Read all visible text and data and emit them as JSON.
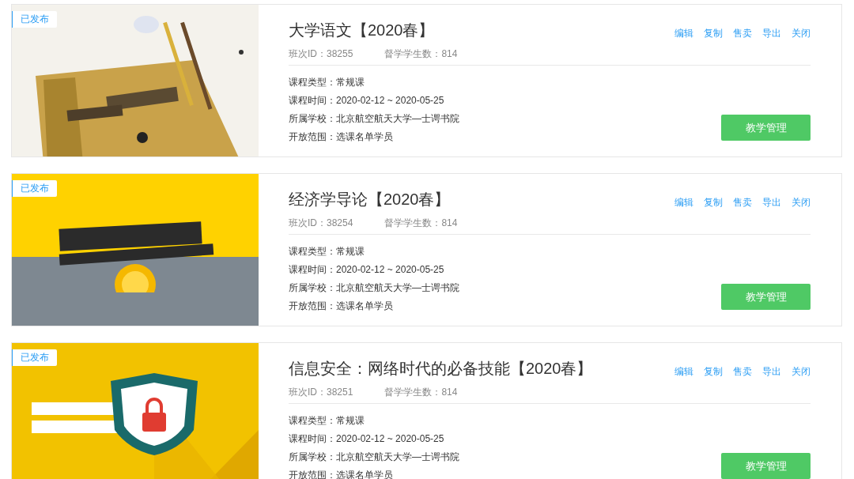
{
  "courses": [
    {
      "kind": "picture",
      "status": "已发布",
      "title": "大学语文【2020春】",
      "class_id": "班次ID：38255",
      "students": "督学学生数：814",
      "actions": [
        "编辑",
        "复制",
        "售卖",
        "导出",
        "关闭"
      ],
      "details": [
        "课程类型：常规课",
        "课程时间：2020-02-12 ~ 2020-05-25",
        "所属学校：北京航空航天大学—士谔书院",
        "开放范围：选课名单学员"
      ],
      "button": "教学管理"
    },
    {
      "kind": "picture",
      "status": "已发布",
      "title": "经济学导论【2020春】",
      "class_id": "班次ID：38254",
      "students": "督学学生数：814",
      "actions": [
        "编辑",
        "复制",
        "售卖",
        "导出",
        "关闭"
      ],
      "details": [
        "课程类型：常规课",
        "课程时间：2020-02-12 ~ 2020-05-25",
        "所属学校：北京航空航天大学—士谔书院",
        "开放范围：选课名单学员"
      ],
      "button": "教学管理"
    },
    {
      "kind": "picture",
      "status": "已发布",
      "title": "信息安全：网络时代的必备技能【2020春】",
      "class_id": "班次ID：38251",
      "students": "督学学生数：814",
      "actions": [
        "编辑",
        "复制",
        "售卖",
        "导出",
        "关闭"
      ],
      "details": [
        "课程类型：常规课",
        "课程时间：2020-02-12 ~ 2020-05-25",
        "所属学校：北京航空航天大学—士谔书院",
        "开放范围：选课名单学员"
      ],
      "button": "教学管理"
    }
  ]
}
